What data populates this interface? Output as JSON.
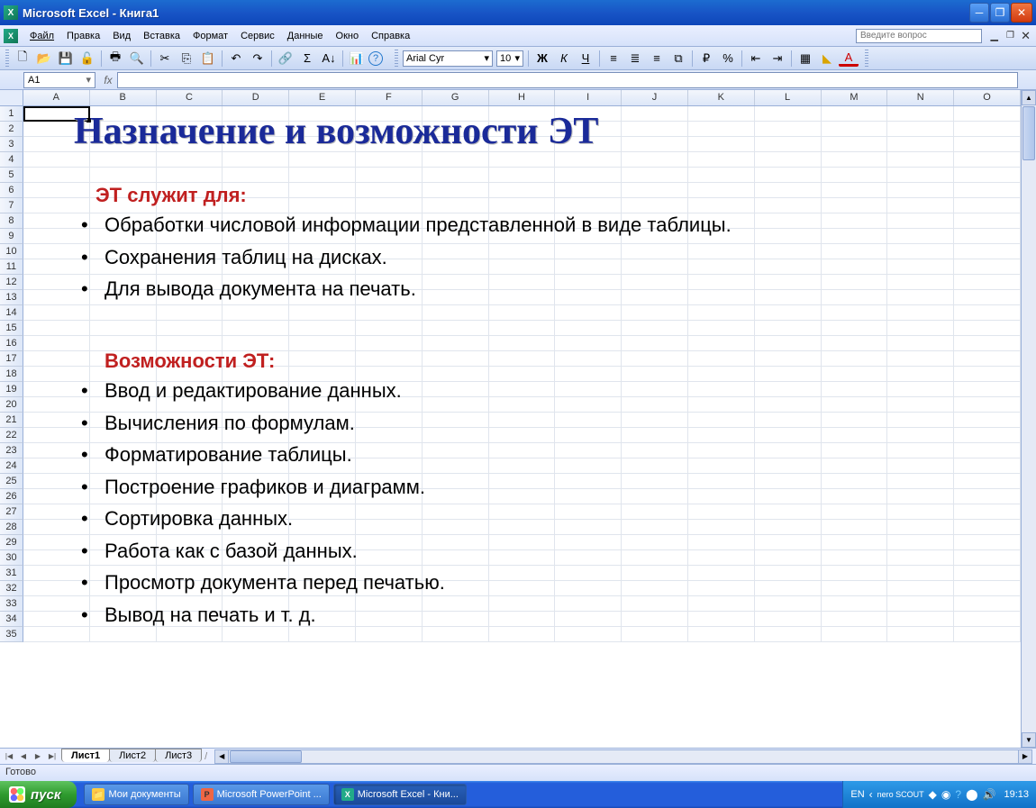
{
  "app": {
    "title": "Microsoft Excel - Книга1"
  },
  "menu": {
    "file": "Файл",
    "edit": "Правка",
    "view": "Вид",
    "insert": "Вставка",
    "format": "Формат",
    "tools": "Сервис",
    "data": "Данные",
    "window": "Окно",
    "help": "Справка",
    "question_placeholder": "Введите вопрос"
  },
  "toolbar2": {
    "font": "Arial Cyr",
    "size": "10",
    "bold": "Ж",
    "italic": "К",
    "underline": "Ч"
  },
  "namebox": "A1",
  "columns": [
    "A",
    "B",
    "C",
    "D",
    "E",
    "F",
    "G",
    "H",
    "I",
    "J",
    "K",
    "L",
    "M",
    "N",
    "O"
  ],
  "row_count": 35,
  "overlay": {
    "title": "Назначение и возможности ЭТ",
    "sub1": "ЭТ служит для:",
    "list1": [
      "Обработки числовой информации представленной в виде таблицы.",
      "Сохранения таблиц на дисках.",
      "Для вывода документа на печать."
    ],
    "sub2": "Возможности ЭТ:",
    "list2": [
      "Ввод и редактирование данных.",
      "Вычисления по формулам.",
      "Форматирование таблицы.",
      "Построение графиков и диаграмм.",
      "Сортировка данных.",
      "Работа как с базой данных.",
      "Просмотр документа перед печатью.",
      "Вывод на печать и т. д."
    ]
  },
  "sheets": {
    "s1": "Лист1",
    "s2": "Лист2",
    "s3": "Лист3"
  },
  "status": "Готово",
  "taskbar": {
    "start": "пуск",
    "btn1": "Мои документы",
    "btn2": "Microsoft PowerPoint ...",
    "btn3": "Microsoft Excel - Кни...",
    "lang": "EN",
    "nero": "nero SCOUT",
    "time": "19:13"
  }
}
